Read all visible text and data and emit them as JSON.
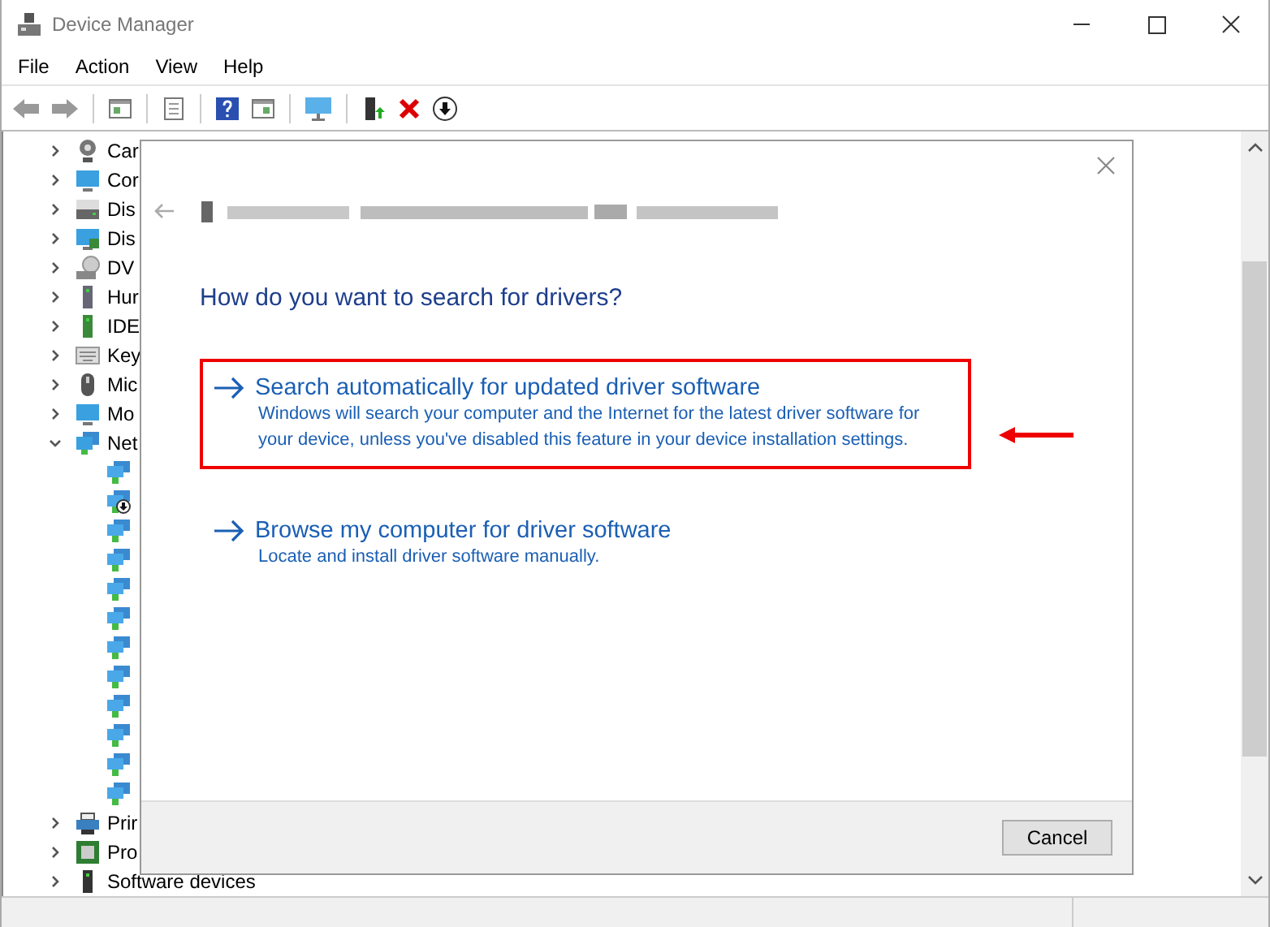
{
  "window": {
    "title": "Device Manager"
  },
  "menu": [
    "File",
    "Action",
    "View",
    "Help"
  ],
  "tree": [
    {
      "label": "Car",
      "kind": "camera",
      "expanded": false
    },
    {
      "label": "Cor",
      "kind": "monitor",
      "expanded": false
    },
    {
      "label": "Dis",
      "kind": "disk",
      "expanded": false
    },
    {
      "label": "Dis",
      "kind": "display",
      "expanded": false
    },
    {
      "label": "DV",
      "kind": "dvd",
      "expanded": false
    },
    {
      "label": "Hur",
      "kind": "hid",
      "expanded": false
    },
    {
      "label": "IDE",
      "kind": "ide",
      "expanded": false
    },
    {
      "label": "Key",
      "kind": "keyboard",
      "expanded": false
    },
    {
      "label": "Mic",
      "kind": "mouse",
      "expanded": false
    },
    {
      "label": "Mo",
      "kind": "monitor",
      "expanded": false
    },
    {
      "label": "Net",
      "kind": "network",
      "expanded": true,
      "children": [
        {
          "kind": "adapter"
        },
        {
          "kind": "adapter-badge"
        },
        {
          "kind": "adapter"
        },
        {
          "kind": "adapter"
        },
        {
          "kind": "adapter"
        },
        {
          "kind": "adapter"
        },
        {
          "kind": "adapter"
        },
        {
          "kind": "adapter"
        },
        {
          "kind": "adapter"
        },
        {
          "kind": "adapter"
        },
        {
          "kind": "adapter"
        },
        {
          "kind": "adapter"
        }
      ]
    },
    {
      "label": "Prir",
      "kind": "printer",
      "expanded": false
    },
    {
      "label": "Pro",
      "kind": "processor",
      "expanded": false
    },
    {
      "label": "Software devices",
      "kind": "software",
      "expanded": false
    }
  ],
  "dialog": {
    "heading": "How do you want to search for drivers?",
    "options": [
      {
        "title": "Search automatically for updated driver software",
        "description": "Windows will search your computer and the Internet for the latest driver software for your device, unless you've disabled this feature in your device installation settings.",
        "highlighted": true
      },
      {
        "title": "Browse my computer for driver software",
        "description": "Locate and install driver software manually.",
        "highlighted": false
      }
    ],
    "cancel": "Cancel"
  }
}
